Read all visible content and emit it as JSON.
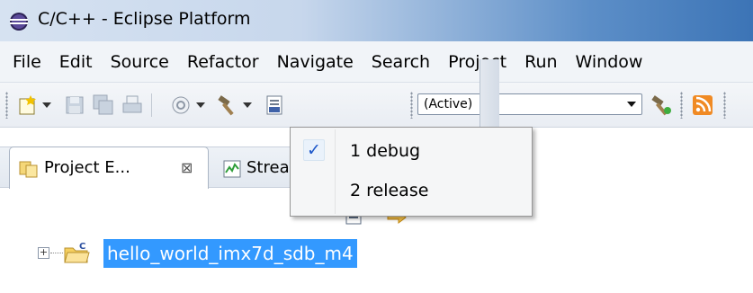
{
  "window": {
    "title": "C/C++ - Eclipse Platform",
    "icon": "eclipse-icon"
  },
  "menubar": {
    "items": [
      "File",
      "Edit",
      "Source",
      "Refactor",
      "Navigate",
      "Search",
      "Project",
      "Run",
      "Window"
    ]
  },
  "toolbar": {
    "active_config": "(Active)",
    "icons": [
      "new-icon",
      "save-icon",
      "save-all-icon",
      "print-icon",
      "debug-config-icon",
      "build-hammer-icon",
      "binary-file-icon",
      "build-targets-icon",
      "rss-icon"
    ]
  },
  "build_menu": {
    "items": [
      {
        "label": "1 debug",
        "checked": true,
        "check_mark": "✓"
      },
      {
        "label": "2 release",
        "checked": false
      }
    ]
  },
  "views": {
    "tabs": [
      {
        "label": "Project E...",
        "active": true,
        "close": "⊠"
      },
      {
        "label": "Streams",
        "active": false
      }
    ]
  },
  "tree": {
    "expander": "+",
    "items": [
      {
        "label": "hello_world_imx7d_sdb_m4",
        "selected": true
      }
    ]
  },
  "colors": {
    "selection": "#3399ff",
    "check": "#1b56c9"
  }
}
